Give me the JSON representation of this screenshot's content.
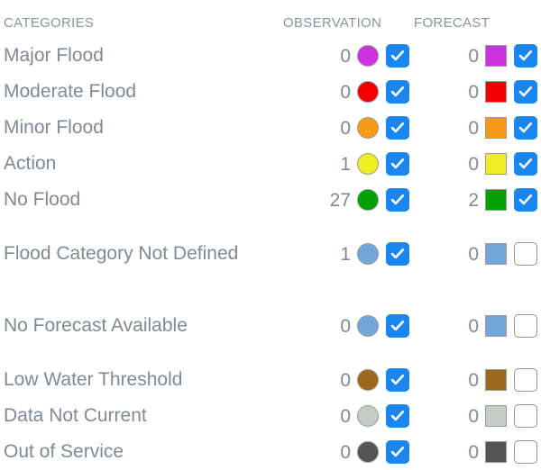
{
  "header": {
    "categories_label": "CATEGORIES",
    "observation_label": "OBSERVATION",
    "forecast_label": "FORECAST"
  },
  "colors": {
    "checkbox_checked": "#1a87f0",
    "checkbox_unchecked_border": "#8e959b",
    "text": "#7e8a95",
    "header_text": "#8a949d",
    "swatch_border": "#9a9a9a"
  },
  "rows": [
    {
      "category": "Major Flood",
      "observation": {
        "count": "0",
        "color": "#cc33dd",
        "checked": true
      },
      "forecast": {
        "count": "0",
        "color": "#cc33dd",
        "checked": true
      }
    },
    {
      "category": "Moderate Flood",
      "observation": {
        "count": "0",
        "color": "#f20000",
        "checked": true
      },
      "forecast": {
        "count": "0",
        "color": "#f20000",
        "checked": true
      }
    },
    {
      "category": "Minor Flood",
      "observation": {
        "count": "0",
        "color": "#f49a16",
        "checked": true
      },
      "forecast": {
        "count": "0",
        "color": "#f49a16",
        "checked": true
      }
    },
    {
      "category": "Action",
      "observation": {
        "count": "1",
        "color": "#eeee22",
        "checked": true
      },
      "forecast": {
        "count": "0",
        "color": "#eeee22",
        "checked": true
      }
    },
    {
      "category": "No Flood",
      "observation": {
        "count": "27",
        "color": "#00a000",
        "checked": true
      },
      "forecast": {
        "count": "2",
        "color": "#00a000",
        "checked": true
      }
    },
    {
      "category": "Flood Category Not Defined",
      "observation": {
        "count": "1",
        "color": "#71a8dc",
        "checked": true
      },
      "forecast": {
        "count": "0",
        "color": "#71a8dc",
        "checked": false
      }
    },
    {
      "category": "No Forecast Available",
      "observation": {
        "count": "0",
        "color": "#71a8dc",
        "checked": true
      },
      "forecast": {
        "count": "0",
        "color": "#71a8dc",
        "checked": false
      }
    },
    {
      "category": "Low Water Threshold",
      "observation": {
        "count": "0",
        "color": "#9c6a1e",
        "checked": true
      },
      "forecast": {
        "count": "0",
        "color": "#9c6a1e",
        "checked": false
      }
    },
    {
      "category": "Data Not Current",
      "observation": {
        "count": "0",
        "color": "#c5ccc6",
        "checked": true
      },
      "forecast": {
        "count": "0",
        "color": "#c5ccc6",
        "checked": false
      }
    },
    {
      "category": "Out of Service",
      "observation": {
        "count": "0",
        "color": "#555555",
        "checked": true
      },
      "forecast": {
        "count": "0",
        "color": "#555555",
        "checked": false
      }
    }
  ]
}
